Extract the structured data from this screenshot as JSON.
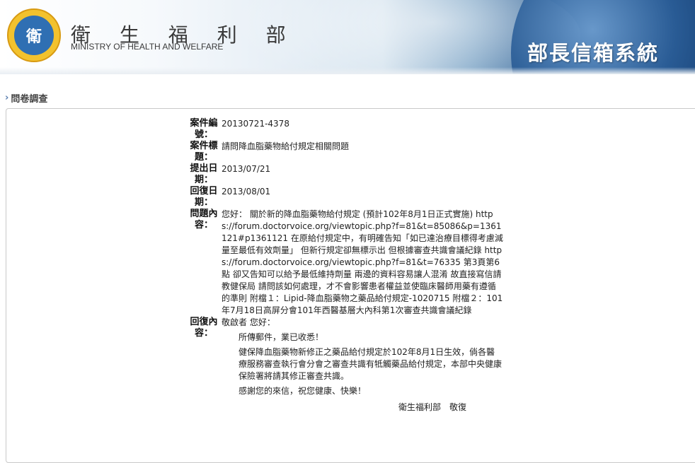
{
  "header": {
    "org_name_zh": "衛 生 福 利 部",
    "org_name_en": "MINISTRY OF HEALTH AND WELFARE",
    "system_title": "部長信箱系統",
    "logo_icon": "ministry-emblem"
  },
  "section": {
    "title": "問卷調查"
  },
  "case": {
    "case_no_label": "案件編號：",
    "case_no": "20130721-4378",
    "subject_label": "案件標題：",
    "subject": "請問降血脂藥物給付規定相關問題",
    "submit_date_label": "提出日期：",
    "submit_date": "2013/07/21",
    "reply_date_label": "回復日期：",
    "reply_date": "2013/08/01",
    "question_label": "問題內容：",
    "question": "您好： 關於新的降血脂藥物給付規定 (預計102年8月1日正式實施) https://forum.doctorvoice.org/viewtopic.php?f=81&t=85086&p=1361121#p1361121 在原給付規定中，有明確告知「如已達治療目標得考慮減量至最低有效劑量」 但新行規定卻無標示出 但根據審查共識會議紀錄 https://forum.doctorvoice.org/viewtopic.php?f=81&t=76335 第3頁第6點 卻又告知可以給予最低維持劑量 兩邊的資料容易讓人混淆 故直接寫信請教健保局 請問該如何處理，才不會影響患者權益並使臨床醫師用藥有遵循的準則 附檔１：Lipid-降血脂藥物之藥品給付規定-1020715 附檔２：101年7月18日高屏分會101年西醫基層大內科第1次審查共識會議紀錄",
    "answer_label": "回復內容：",
    "answer": {
      "greeting": "敬啟者 您好：",
      "line1": "所傳郵件，業已收悉！",
      "line2": "健保降血脂藥物新修正之藥品給付規定於102年8月1日生效，倘各醫療服務審查執行會分會之審查共識有牴觸藥品給付規定，本部中央健康保險署將請其修正審查共識。",
      "line3": "感謝您的來信，祝您健康、快樂！",
      "signature": "衛生福利部　敬復"
    }
  },
  "colors": {
    "header_dark_blue": "#163f74",
    "logo_gold": "#f2c22e",
    "panel_border": "#c9c9c9"
  }
}
